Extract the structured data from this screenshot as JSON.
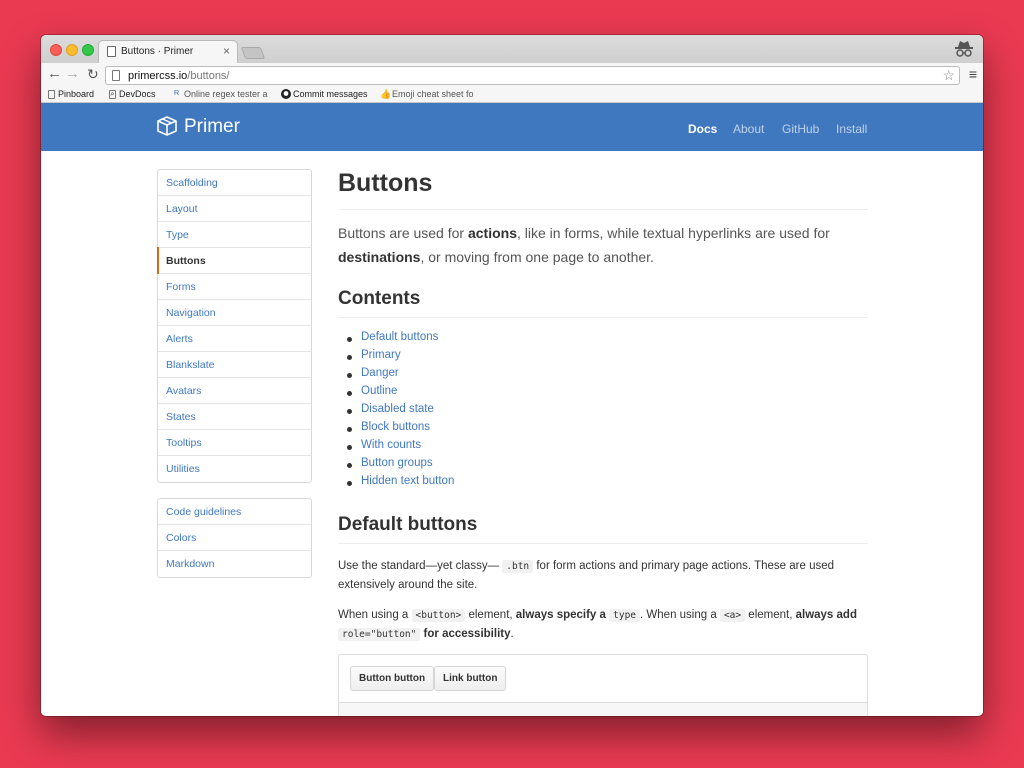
{
  "browser": {
    "tab_title": "Buttons · Primer",
    "tab_close": "×",
    "url_host": "primercss.io",
    "url_path": "/buttons/",
    "bookmarks": [
      {
        "label": "Pinboard",
        "icon": "page-icon"
      },
      {
        "label": "DevDocs",
        "icon": "search-icon"
      },
      {
        "label": "Online regex tester a",
        "icon": "regex-icon"
      },
      {
        "label": "Commit messages",
        "icon": "github-icon"
      },
      {
        "label": "Emoji cheat sheet fo",
        "icon": "thumbs-up-icon"
      }
    ]
  },
  "site": {
    "logo": "Primer",
    "nav": [
      "Docs",
      "About",
      "GitHub",
      "Install"
    ],
    "accent_color": "#4078c0"
  },
  "sidebar": {
    "main": [
      "Scaffolding",
      "Layout",
      "Type",
      "Buttons",
      "Forms",
      "Navigation",
      "Alerts",
      "Blankslate",
      "Avatars",
      "States",
      "Tooltips",
      "Utilities"
    ],
    "selected": "Buttons",
    "secondary": [
      "Code guidelines",
      "Colors",
      "Markdown"
    ]
  },
  "page": {
    "title": "Buttons",
    "lead": {
      "t1": "Buttons are used for ",
      "b1": "actions",
      "t2": ", like in forms, while textual hyperlinks are used for ",
      "b2": "destinations",
      "t3": ", or moving from one page to another."
    },
    "contents_heading": "Contents",
    "toc": [
      "Default buttons",
      "Primary",
      "Danger",
      "Outline",
      "Disabled state",
      "Block buttons",
      "With counts",
      "Button groups",
      "Hidden text button"
    ],
    "default_heading": "Default buttons",
    "p1": {
      "t1": "Use the standard—yet classy— ",
      "code1": ".btn",
      "t2": " for form actions and primary page actions. These are used extensively around the site."
    },
    "p2": {
      "t1": "When using a ",
      "code1": "<button>",
      "t2": " element, ",
      "b1": "always specify a",
      "code2": "type",
      "t3": ". When using a ",
      "code3": "<a>",
      "t4": " element, ",
      "b2": "always add",
      "code4": "role=\"button\"",
      "b3": " for accessibility",
      "t5": "."
    },
    "example_buttons": [
      "Button button",
      "Link button"
    ]
  }
}
